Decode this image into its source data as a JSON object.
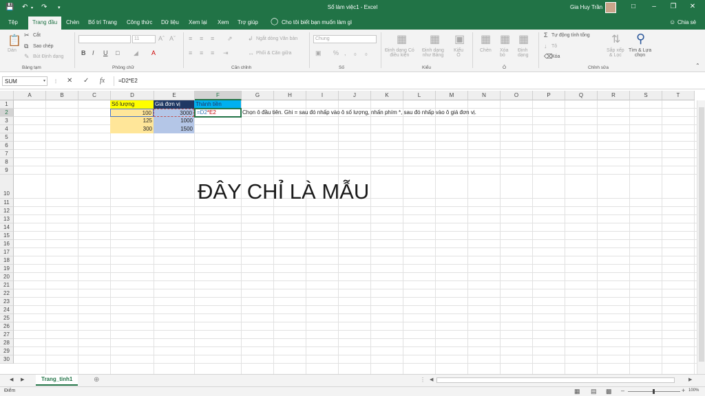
{
  "window": {
    "title": "Sổ làm việc1  -  Excel",
    "user": "Gia Huy Trần",
    "share": "Chia sẻ"
  },
  "tabs": [
    "Tệp",
    "Trang đầu",
    "Chèn",
    "Bố trí Trang",
    "Công thức",
    "Dữ liệu",
    "Xem lại",
    "Xem",
    "Trợ giúp"
  ],
  "tell_me": "Cho tôi biết bạn muốn làm gì",
  "ribbon": {
    "clipboard": {
      "paste": "Dán",
      "cut": "Cắt",
      "copy": "Sao chép",
      "format_painter": "Bút Định dạng",
      "label": "Bảng tạm"
    },
    "font": {
      "label": "Phông chữ",
      "size": "11"
    },
    "alignment": {
      "wrap": "Ngắt dòng Văn bản",
      "merge": "Phối & Căn giữa",
      "label": "Căn chỉnh"
    },
    "number": {
      "format": "Chung",
      "label": "Số"
    },
    "styles": {
      "conditional": "Định dạng Có\nđiều kiện",
      "table": "Định dạng\nnhư Bảng",
      "cell": "Kiểu\nÔ",
      "label": "Kiểu"
    },
    "cells": {
      "insert": "Chèn",
      "delete": "Xóa\nbỏ",
      "format": "Định\ndạng",
      "label": "Ô"
    },
    "editing": {
      "autosum": "Tự động tính tổng",
      "fill": "Tô",
      "clear": "Xóa",
      "sort": "Sắp xếp\n& Lọc",
      "find": "Tìm & Lựa\nchọn",
      "label": "Chỉnh sửa"
    }
  },
  "formula_bar": {
    "name_box": "SUM",
    "formula": "=D2*E2",
    "fx": "fx"
  },
  "columns": [
    "A",
    "B",
    "C",
    "D",
    "E",
    "F",
    "G",
    "H",
    "I",
    "J",
    "K",
    "L",
    "M",
    "N",
    "O",
    "P",
    "Q",
    "R",
    "S",
    "T"
  ],
  "rows": [
    "1",
    "2",
    "3",
    "4",
    "5",
    "6",
    "7",
    "8",
    "9",
    "10",
    "11",
    "12",
    "13",
    "14",
    "15",
    "16",
    "17",
    "18",
    "19",
    "20",
    "21",
    "22",
    "23",
    "24",
    "25",
    "26",
    "27",
    "28",
    "29",
    "30"
  ],
  "cells": {
    "d1": "Số lượng",
    "e1": "Giá đơn vị",
    "f1": "Thành tiền",
    "d2": "100",
    "e2": "3000",
    "f2_a": "=D2",
    "f2_b": "*E2",
    "g2": "Chọn ô đầu tiên. Ghi = sau đó nhấp vào ô số lượng, nhấn phím *, sau đó nhấp vào ô giá đơn vị.",
    "d3": "125",
    "e3": "1000",
    "d4": "300",
    "e4": "1500"
  },
  "watermark": "ĐÂY CHỈ LÀ MẪU",
  "sheet_tab": "Trang_tinh1",
  "status": {
    "mode": "Điểm",
    "zoom": "100%"
  },
  "colors": {
    "accent": "#217346",
    "header_yellow": "#ffff00",
    "header_blue": "#1f3864",
    "header_cyan": "#00b0f0",
    "tan": "#ffe699",
    "lavender": "#b4c6e7"
  }
}
